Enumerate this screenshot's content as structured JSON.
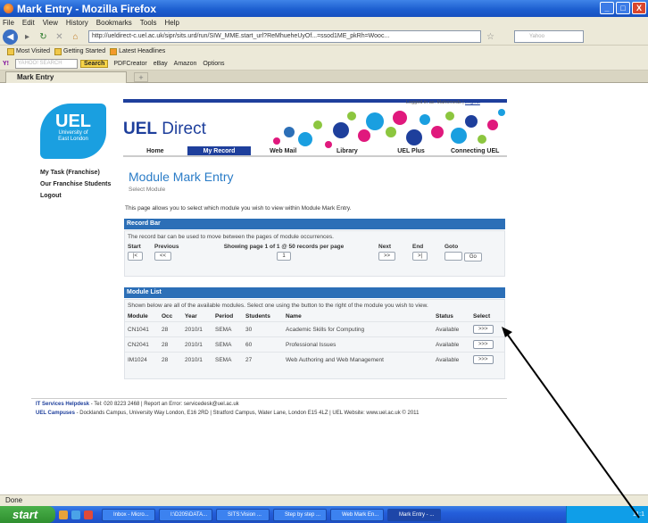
{
  "window": {
    "title": "Mark Entry - Mozilla Firefox",
    "controls": [
      "_",
      "□",
      "X"
    ]
  },
  "menu": [
    "File",
    "Edit",
    "View",
    "History",
    "Bookmarks",
    "Tools",
    "Help"
  ],
  "nav": {
    "url": "http://ueldirect-c.uel.ac.uk/sipr/sits.urd/run/SIW_MME.start_url?ReMhueheUyOf...=ssod1ME_pkRh=Wooc...",
    "search_placeholder": "Yahoo"
  },
  "bookmarks": [
    "Most Visited",
    "Getting Started",
    "Latest Headlines"
  ],
  "yahoo": {
    "label": "YAHOO! SEARCH",
    "search_btn": "Search",
    "items": [
      "PDFCreator",
      "eBay",
      "Amazon",
      "Options"
    ]
  },
  "tab": {
    "label": "Mark Entry",
    "new_tab": "+"
  },
  "header": {
    "logo_big": "UEL",
    "logo_small1": "University of",
    "logo_small2": "East London",
    "title_bold": "UEL",
    "title_rest": " Direct",
    "logged_in": "Logged in as: Mahomeds |",
    "logout": "Logout",
    "nav": [
      "Home",
      "My Record",
      "Web Mail",
      "Library",
      "UEL Plus",
      "Connecting UEL"
    ]
  },
  "sidebar": [
    "My Task (Franchise)",
    "Our Franchise Students",
    "Logout"
  ],
  "main": {
    "heading": "Module Mark Entry",
    "sub": "Select Module",
    "intro": "This page allows you to select which module you wish to view within Module Mark Entry."
  },
  "record_bar": {
    "title": "Record Bar",
    "text": "The record bar can be used to move between the pages of module occurrences.",
    "headers": [
      "Start",
      "Previous",
      "Showing page 1 of 1 @ 50 records per page",
      "Next",
      "End",
      "Goto"
    ],
    "buttons": {
      "start": "|<",
      "prev": "<<",
      "page": "1",
      "next": ">>",
      "end": ">|",
      "go": "Go"
    }
  },
  "module_list": {
    "title": "Module List",
    "text": "Shown below are all of the available modules. Select one using the button to the right of the module you wish to view.",
    "headers": [
      "Module",
      "Occ",
      "Year",
      "Period",
      "Students",
      "Name",
      "Status",
      "Select"
    ],
    "rows": [
      {
        "module": "CN1041",
        "occ": "28",
        "year": "2010/1",
        "period": "SEMA",
        "students": "30",
        "name": "Academic Skills for Computing",
        "status": "Available",
        "select": ">>>"
      },
      {
        "module": "CN2041",
        "occ": "28",
        "year": "2010/1",
        "period": "SEMA",
        "students": "60",
        "name": "Professional Issues",
        "status": "Available",
        "select": ">>>"
      },
      {
        "module": "IM1024",
        "occ": "28",
        "year": "2010/1",
        "period": "SEMA",
        "students": "27",
        "name": "Web Authoring and Web Management",
        "status": "Available",
        "select": ">>>"
      }
    ]
  },
  "footer": {
    "line1_bold": "IT Services Helpdesk",
    "line1": " - Tel: 020 8223 2468 | Report an Error: servicedesk@uel.ac.uk",
    "line2_bold": "UEL Campuses",
    "line2": " - Docklands Campus, University Way London, E16 2RD | Stratford Campus, Water Lane, London E15 4LZ | UEL Website: www.uel.ac.uk © 2011"
  },
  "status": "Done",
  "taskbar": {
    "start": "start",
    "tasks": [
      "Inbox - Micro...",
      "I:\\D205\\DATA...",
      "SITS:Vision ...",
      "Step by step ...",
      "Web Mark En...",
      "Mark Entry - ..."
    ],
    "clock": "11:1"
  },
  "colors": {
    "uel_blue": "#1e3f9c",
    "header_bar": "#2c6fb7",
    "heading": "#2a7cc7"
  }
}
